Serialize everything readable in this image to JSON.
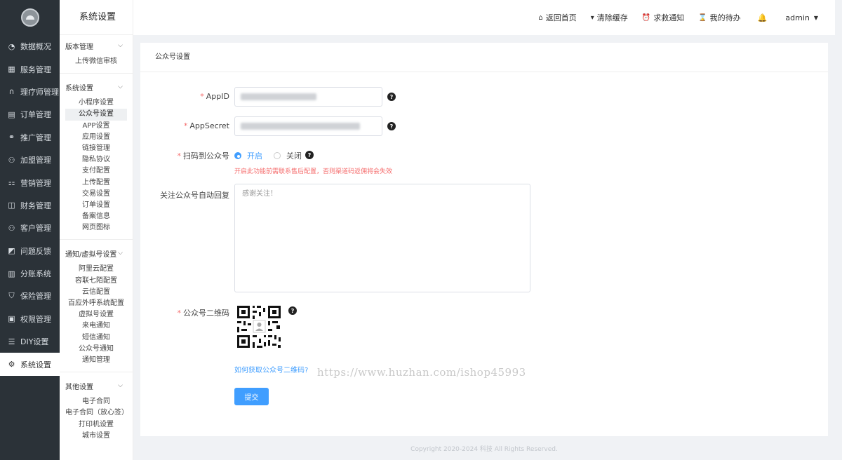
{
  "nav": {
    "items": [
      {
        "label": "数据概况",
        "icon": "pie-chart-icon"
      },
      {
        "label": "服务管理",
        "icon": "calendar-icon"
      },
      {
        "label": "理疗师管理",
        "icon": "headset-icon"
      },
      {
        "label": "订单管理",
        "icon": "clipboard-icon"
      },
      {
        "label": "推广管理",
        "icon": "network-icon"
      },
      {
        "label": "加盟管理",
        "icon": "user-add-icon"
      },
      {
        "label": "营销管理",
        "icon": "marketing-icon"
      },
      {
        "label": "财务管理",
        "icon": "wallet-icon"
      },
      {
        "label": "客户管理",
        "icon": "users-icon"
      },
      {
        "label": "问题反馈",
        "icon": "feedback-icon"
      },
      {
        "label": "分账系统",
        "icon": "bar-chart-icon"
      },
      {
        "label": "保险管理",
        "icon": "shield-icon"
      },
      {
        "label": "权限管理",
        "icon": "lock-icon"
      },
      {
        "label": "DIY设置",
        "icon": "diy-icon"
      },
      {
        "label": "系统设置",
        "icon": "gear-icon",
        "active": true
      }
    ]
  },
  "submenu": {
    "title": "系统设置",
    "groups": [
      {
        "title": "版本管理",
        "items": [
          "上传微信审核"
        ]
      },
      {
        "title": "系统设置",
        "items": [
          "小程序设置",
          "公众号设置",
          "APP设置",
          "应用设置",
          "链接管理",
          "隐私协议",
          "支付配置",
          "上传配置",
          "交易设置",
          "订单设置",
          "备案信息",
          "网页图标"
        ],
        "active": "公众号设置"
      },
      {
        "title": "通知/虚拟号设置",
        "items": [
          "阿里云配置",
          "容联七陌配置",
          "云信配置",
          "百应外呼系统配置",
          "虚拟号设置",
          "来电通知",
          "短信通知",
          "公众号通知",
          "通知管理"
        ]
      },
      {
        "title": "其他设置",
        "items": [
          "电子合同",
          "电子合同（放心签）",
          "打印机设置",
          "城市设置"
        ]
      }
    ]
  },
  "header": {
    "links": [
      {
        "label": "返回首页",
        "icon": "home-icon"
      },
      {
        "label": "清除缓存",
        "icon": "brush-icon"
      },
      {
        "label": "求救通知",
        "icon": "alarm-icon"
      },
      {
        "label": "我的待办",
        "icon": "hourglass-icon"
      }
    ],
    "user": "admin"
  },
  "form": {
    "card_title": "公众号设置",
    "appid_label": "AppID",
    "appsecret_label": "AppSecret",
    "scan_label": "扫码到公众号",
    "radio_on": "开启",
    "radio_off": "关闭",
    "warning": "开启此功能前需联系售后配置，否则渠道码返佣将会失效",
    "reply_label": "关注公众号自动回复",
    "reply_value": "感谢关注！",
    "qr_label": "公众号二维码",
    "qr_link": "如何获取公众号二维码?",
    "watermark": "https://www.huzhan.com/ishop45993",
    "submit": "提交"
  },
  "footer": "Copyright 2020-2024 科技 All Rights Reserved.",
  "colors": {
    "primary": "#409eff",
    "nav_bg": "#2b3238",
    "danger": "#f56c6c"
  }
}
